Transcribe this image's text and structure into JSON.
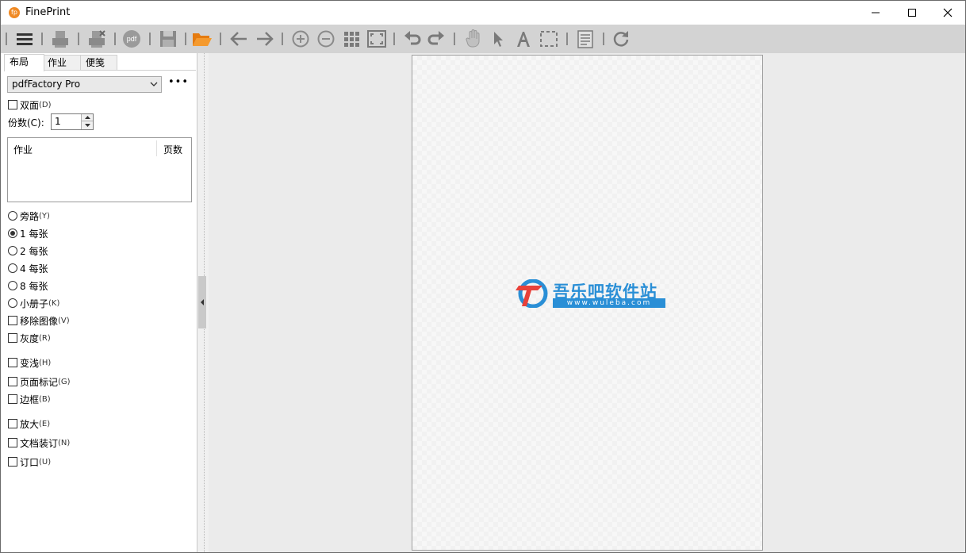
{
  "window": {
    "title": "FinePrint",
    "app_icon": "fp",
    "controls": {
      "minimize": "minimize-icon",
      "maximize": "maximize-icon",
      "close": "close-icon"
    }
  },
  "toolbar": {
    "icons": [
      "menu-icon",
      "print-icon",
      "print-delete-icon",
      "pdf-icon",
      "save-icon",
      "open-folder-icon",
      "arrow-left-icon",
      "arrow-right-icon",
      "zoom-in-icon",
      "zoom-out-icon",
      "thumbnails-icon",
      "fit-page-icon",
      "undo-icon",
      "redo-icon",
      "hand-icon",
      "pointer-icon",
      "text-icon",
      "select-rect-icon",
      "letterhead-icon",
      "refresh-icon"
    ],
    "pdf_label": "pdf"
  },
  "colors": {
    "accent_orange": "#f08a24",
    "watermark_blue": "#2a8fd6",
    "watermark_red": "#e8413a"
  },
  "sidebar": {
    "tabs": [
      {
        "label": "布局",
        "active": true
      },
      {
        "label": "作业",
        "active": false
      },
      {
        "label": "便笺",
        "active": false
      }
    ],
    "printer": {
      "selected": "pdfFactory Pro",
      "more": "•••"
    },
    "duplex": {
      "label": "双面",
      "shortcut": "(D)",
      "checked": false
    },
    "copies": {
      "label": "份数(C):",
      "value": "1"
    },
    "joblist": {
      "col_job": "作业",
      "col_pages": "页数"
    },
    "layout_options": [
      {
        "label": "旁路",
        "shortcut": "(Y)",
        "selected": false
      },
      {
        "label": "1 每张",
        "shortcut": "",
        "selected": true
      },
      {
        "label": "2 每张",
        "shortcut": "",
        "selected": false
      },
      {
        "label": "4 每张",
        "shortcut": "",
        "selected": false
      },
      {
        "label": "8 每张",
        "shortcut": "",
        "selected": false
      },
      {
        "label": "小册子",
        "shortcut": "(K)",
        "selected": false
      }
    ],
    "checkboxes": [
      {
        "label": "移除图像",
        "shortcut": "(V)",
        "checked": false
      },
      {
        "label": "灰度",
        "shortcut": "(R)",
        "checked": false
      },
      {
        "label": "变浅",
        "shortcut": "(H)",
        "checked": false
      },
      {
        "label": "页面标记",
        "shortcut": "(G)",
        "checked": false
      },
      {
        "label": "边框",
        "shortcut": "(B)",
        "checked": false
      },
      {
        "label": "放大",
        "shortcut": "(E)",
        "checked": false
      },
      {
        "label": "文档装订",
        "shortcut": "(N)",
        "checked": false
      },
      {
        "label": "订口",
        "shortcut": "(U)",
        "checked": false
      }
    ]
  },
  "preview": {
    "watermark_title": "吾乐吧软件站",
    "watermark_url": "www.wuleba.com"
  }
}
